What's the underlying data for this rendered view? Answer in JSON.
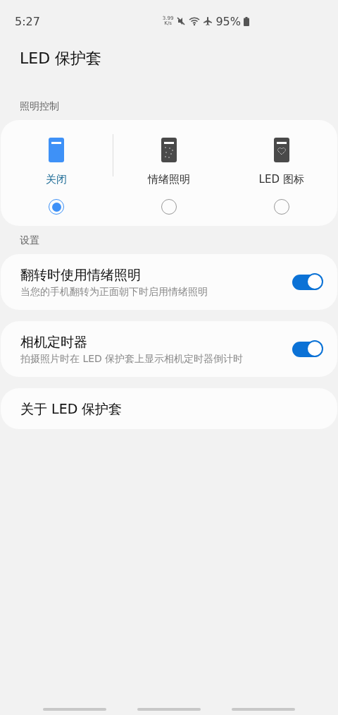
{
  "status_bar": {
    "time": "5:27",
    "speed_value": "3.99",
    "speed_unit": "K/s",
    "battery": "95%"
  },
  "title": "LED 保护套",
  "lighting": {
    "header": "照明控制",
    "options": [
      {
        "kind": "off",
        "label": "关闭",
        "selected": true
      },
      {
        "kind": "mood",
        "label": "情绪照明",
        "selected": false
      },
      {
        "kind": "icon",
        "label": "LED 图标",
        "selected": false
      }
    ]
  },
  "settings": {
    "header": "设置",
    "items": [
      {
        "kind": "switch",
        "title": "翻转时使用情绪照明",
        "description": "当您的手机翻转为正面朝下时启用情绪照明",
        "on": true
      },
      {
        "kind": "switch",
        "title": "相机定时器",
        "description": "拍摄照片时在 LED 保护套上显示相机定时器倒计时",
        "on": true
      },
      {
        "kind": "link",
        "title": "关于 LED 保护套"
      }
    ]
  }
}
